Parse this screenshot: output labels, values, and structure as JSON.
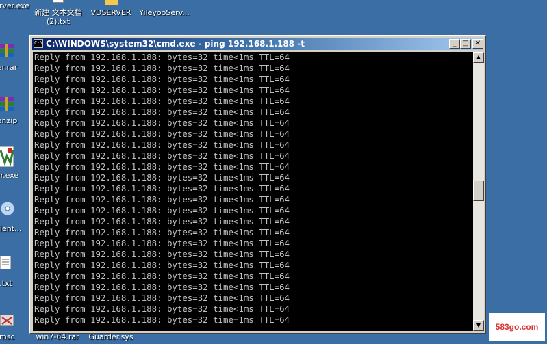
{
  "desktop": {
    "top_icons": [
      {
        "label": "rver.exe"
      },
      {
        "label": "新建 文本文档 (2).txt"
      },
      {
        "label": "VDSERVER"
      },
      {
        "label": "YileyooServ..."
      }
    ],
    "left_icons": [
      {
        "label": "rver.rar"
      },
      {
        "label": "rver.zip"
      },
      {
        "label": "rver.exe"
      },
      {
        "label": "oClient..."
      },
      {
        "label": "d.txt"
      }
    ],
    "bottom_icons": [
      {
        "label": "盘.msc"
      },
      {
        "label": "win7-64.rar"
      },
      {
        "label": "Guarder.sys"
      }
    ]
  },
  "window": {
    "title": "C:\\WINDOWS\\system32\\cmd.exe - ping 192.168.1.188 -t",
    "icon_text": "C:\\",
    "minimize": "_",
    "maximize": "□",
    "close": "✕"
  },
  "console": {
    "lines": [
      "Reply from 192.168.1.188: bytes=32 time<1ms TTL=64",
      "Reply from 192.168.1.188: bytes=32 time<1ms TTL=64",
      "Reply from 192.168.1.188: bytes=32 time<1ms TTL=64",
      "Reply from 192.168.1.188: bytes=32 time<1ms TTL=64",
      "Reply from 192.168.1.188: bytes=32 time<1ms TTL=64",
      "Reply from 192.168.1.188: bytes=32 time<1ms TTL=64",
      "Reply from 192.168.1.188: bytes=32 time<1ms TTL=64",
      "Reply from 192.168.1.188: bytes=32 time<1ms TTL=64",
      "Reply from 192.168.1.188: bytes=32 time<1ms TTL=64",
      "Reply from 192.168.1.188: bytes=32 time<1ms TTL=64",
      "Reply from 192.168.1.188: bytes=32 time<1ms TTL=64",
      "Reply from 192.168.1.188: bytes=32 time<1ms TTL=64",
      "Reply from 192.168.1.188: bytes=32 time<1ms TTL=64",
      "Reply from 192.168.1.188: bytes=32 time<1ms TTL=64",
      "Reply from 192.168.1.188: bytes=32 time<1ms TTL=64",
      "Reply from 192.168.1.188: bytes=32 time<1ms TTL=64",
      "Reply from 192.168.1.188: bytes=32 time<1ms TTL=64",
      "Reply from 192.168.1.188: bytes=32 time<1ms TTL=64",
      "Reply from 192.168.1.188: bytes=32 time<1ms TTL=64",
      "Reply from 192.168.1.188: bytes=32 time<1ms TTL=64",
      "Reply from 192.168.1.188: bytes=32 time<1ms TTL=64",
      "Reply from 192.168.1.188: bytes=32 time<1ms TTL=64",
      "Reply from 192.168.1.188: bytes=32 time<1ms TTL=64",
      "Reply from 192.168.1.188: bytes=32 time<1ms TTL=64",
      "Reply from 192.168.1.188: bytes=32 time=1ms TTL=64"
    ]
  },
  "scrollbar": {
    "up": "▲",
    "down": "▼"
  },
  "watermark": {
    "text": "583go.com"
  },
  "colors": {
    "desktop": "#3a6ea5",
    "titlebar_start": "#0a246a",
    "titlebar_end": "#a6caf0",
    "console_bg": "#000000",
    "console_text": "#c0c0c0"
  }
}
